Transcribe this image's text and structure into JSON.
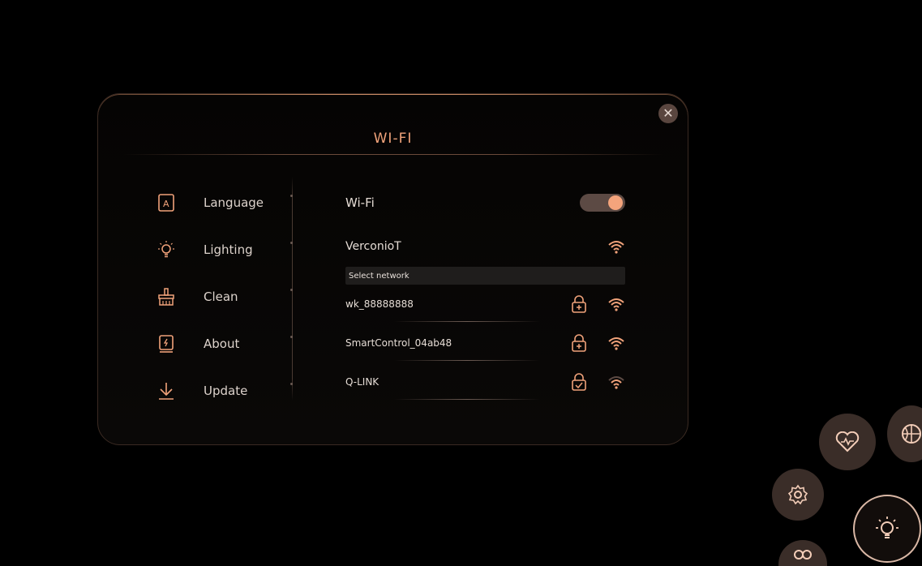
{
  "dialog": {
    "title": "WI-FI"
  },
  "sidebar": {
    "items": [
      {
        "label": "Language",
        "icon": "language-icon"
      },
      {
        "label": "Lighting",
        "icon": "bulb-icon"
      },
      {
        "label": "Clean",
        "icon": "broom-icon"
      },
      {
        "label": "About",
        "icon": "about-icon"
      },
      {
        "label": "Update",
        "icon": "download-icon"
      }
    ]
  },
  "wifi": {
    "label": "Wi-Fi",
    "enabled": true,
    "connected_network": "VerconioT",
    "select_label": "Select network",
    "networks": [
      {
        "name": "wk_88888888",
        "lock": "lock-plus-icon"
      },
      {
        "name": "SmartControl_04ab48",
        "lock": "lock-plus-icon"
      },
      {
        "name": "Q-LINK",
        "lock": "lock-check-icon"
      }
    ]
  },
  "colors": {
    "accent": "#f0a27a",
    "panel_border": "#3a2a22",
    "toggle_track": "#5c4a44",
    "orb": "#3a2d28"
  }
}
